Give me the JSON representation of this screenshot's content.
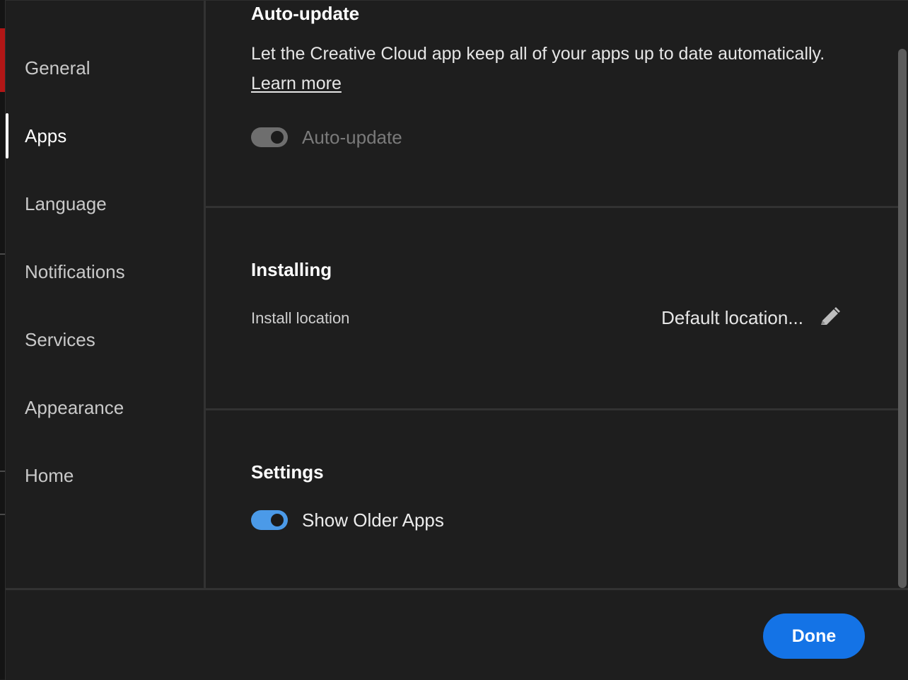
{
  "sidebar": {
    "items": [
      {
        "label": "General",
        "active": false
      },
      {
        "label": "Apps",
        "active": true
      },
      {
        "label": "Language",
        "active": false
      },
      {
        "label": "Notifications",
        "active": false
      },
      {
        "label": "Services",
        "active": false
      },
      {
        "label": "Appearance",
        "active": false
      },
      {
        "label": "Home",
        "active": false
      }
    ]
  },
  "auto_update": {
    "heading": "Auto-update",
    "description": "Let the Creative Cloud app keep all of your apps up to date automatically.",
    "learn_more": "Learn more",
    "toggle_label": "Auto-update",
    "toggle_state": "on-disabled"
  },
  "installing": {
    "heading": "Installing",
    "install_location_label": "Install location",
    "install_location_value": "Default location...",
    "edit_icon": "pencil-icon"
  },
  "settings": {
    "heading": "Settings",
    "toggle_label": "Show Older Apps",
    "toggle_state": "on"
  },
  "footer": {
    "done_label": "Done"
  },
  "colors": {
    "accent": "#1473e6",
    "toggle_on": "#4b9ae8",
    "background": "#1e1e1e"
  }
}
